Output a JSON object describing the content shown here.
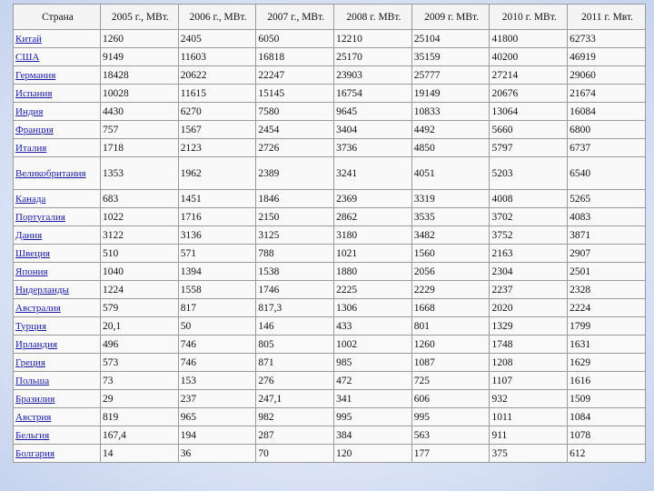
{
  "table": {
    "headers": [
      "Страна",
      "2005 г., МВт.",
      "2006 г., МВт.",
      "2007 г., МВт.",
      "2008 г. МВт.",
      "2009 г. МВт.",
      "2010 г. МВт.",
      "2011 г. Мвт."
    ],
    "rows": [
      [
        "Китай",
        "1260",
        "2405",
        "6050",
        "12210",
        "25104",
        "41800",
        "62733"
      ],
      [
        "США",
        "9149",
        "11603",
        "16818",
        "25170",
        "35159",
        "40200",
        "46919"
      ],
      [
        "Германия",
        "18428",
        "20622",
        "22247",
        "23903",
        "25777",
        "27214",
        "29060"
      ],
      [
        "Испания",
        "10028",
        "11615",
        "15145",
        "16754",
        "19149",
        "20676",
        "21674"
      ],
      [
        "Индия",
        "4430",
        "6270",
        "7580",
        "9645",
        "10833",
        "13064",
        "16084"
      ],
      [
        "Франция",
        "757",
        "1567",
        "2454",
        "3404",
        "4492",
        "5660",
        "6800"
      ],
      [
        "Италия",
        "1718",
        "2123",
        "2726",
        "3736",
        "4850",
        "5797",
        "6737"
      ],
      [
        "Великобритания",
        "1353",
        "1962",
        "2389",
        "3241",
        "4051",
        "5203",
        "6540"
      ],
      [
        "Канада",
        "683",
        "1451",
        "1846",
        "2369",
        "3319",
        "4008",
        "5265"
      ],
      [
        "Португалия",
        "1022",
        "1716",
        "2150",
        "2862",
        "3535",
        "3702",
        "4083"
      ],
      [
        "Дания",
        "3122",
        "3136",
        "3125",
        "3180",
        "3482",
        "3752",
        "3871"
      ],
      [
        "Швеция",
        "510",
        "571",
        "788",
        "1021",
        "1560",
        "2163",
        "2907"
      ],
      [
        "Япония",
        "1040",
        "1394",
        "1538",
        "1880",
        "2056",
        "2304",
        "2501"
      ],
      [
        "Нидерланды",
        "1224",
        "1558",
        "1746",
        "2225",
        "2229",
        "2237",
        "2328"
      ],
      [
        "Австралия",
        "579",
        "817",
        "817,3",
        "1306",
        "1668",
        "2020",
        "2224"
      ],
      [
        "Турция",
        "20,1",
        "50",
        "146",
        "433",
        "801",
        "1329",
        "1799"
      ],
      [
        "Ирландия",
        "496",
        "746",
        "805",
        "1002",
        "1260",
        "1748",
        "1631"
      ],
      [
        "Греция",
        "573",
        "746",
        "871",
        "985",
        "1087",
        "1208",
        "1629"
      ],
      [
        "Польша",
        "73",
        "153",
        "276",
        "472",
        "725",
        "1107",
        "1616"
      ],
      [
        "Бразилия",
        "29",
        "237",
        "247,1",
        "341",
        "606",
        "932",
        "1509"
      ],
      [
        "Австрия",
        "819",
        "965",
        "982",
        "995",
        "995",
        "1011",
        "1084"
      ],
      [
        "Бельгия",
        "167,4",
        "194",
        "287",
        "384",
        "563",
        "911",
        "1078"
      ],
      [
        "Болгария",
        "14",
        "36",
        "70",
        "120",
        "177",
        "375",
        "612"
      ]
    ]
  },
  "colors": {
    "link": "#1a1aa6",
    "background": "#dde5f6",
    "table": "#f9f9f9",
    "border": "#9a9a9a"
  }
}
